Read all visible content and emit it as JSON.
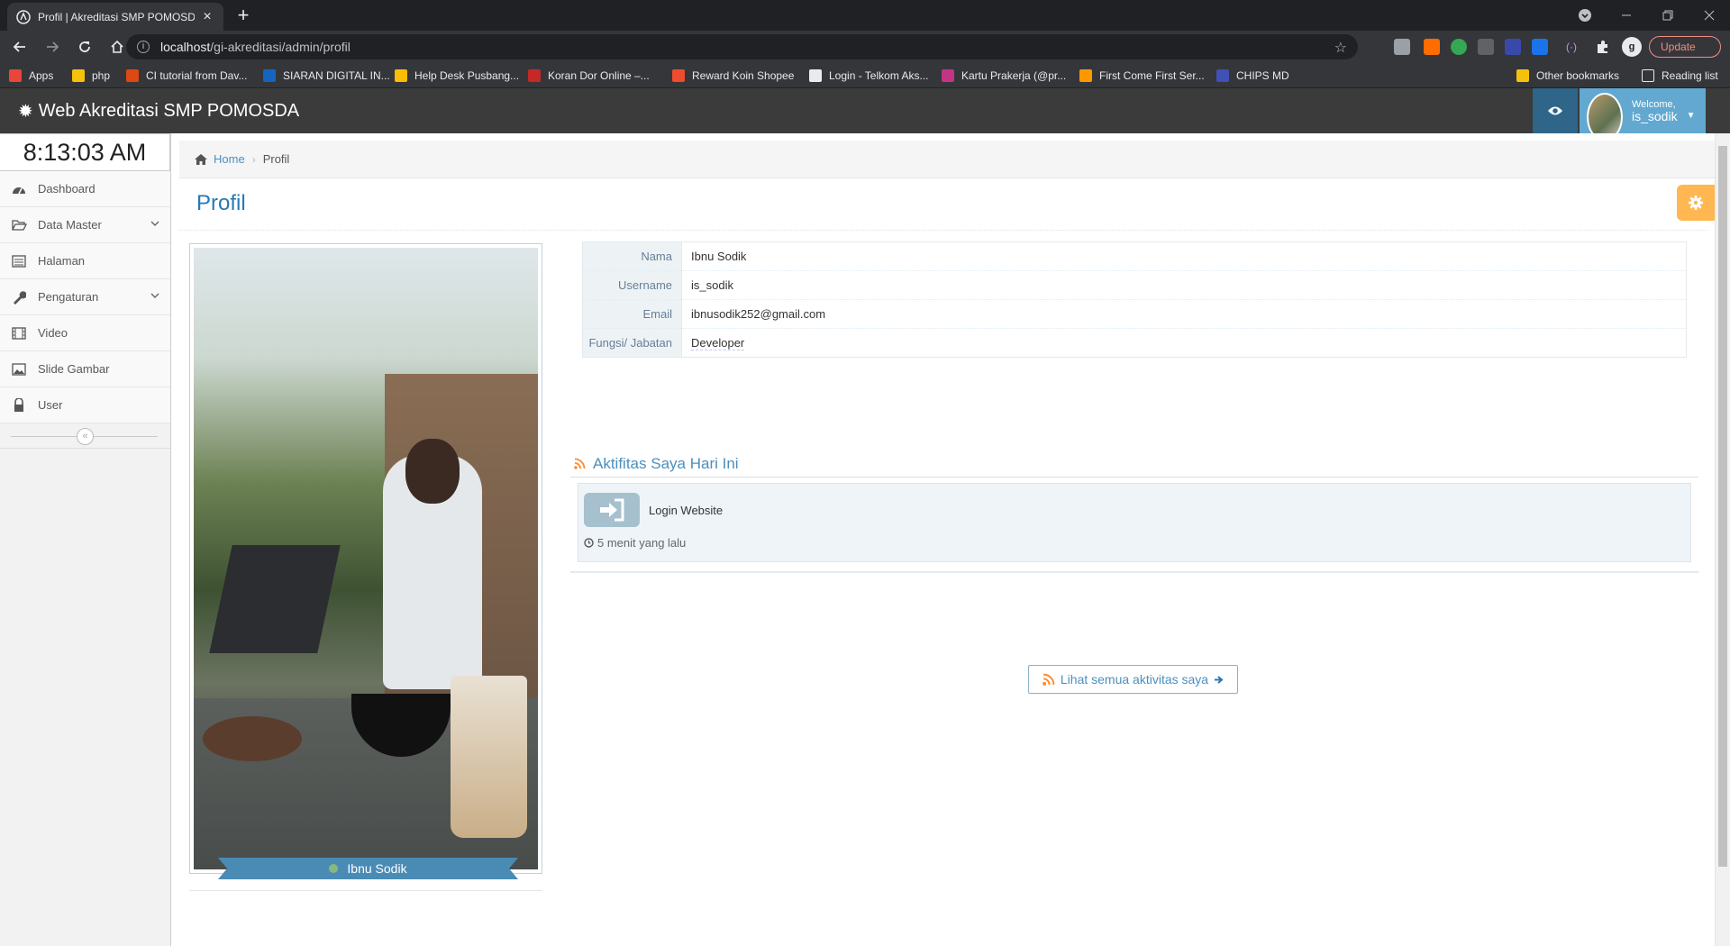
{
  "browser": {
    "tab_title": "Profil | Akreditasi SMP POMOSDA",
    "tab_close": "×",
    "new_tab": "+",
    "url_host": "localhost",
    "url_path": "/gi-akreditasi/admin/profil",
    "update_label": "Update",
    "bookmarks": [
      {
        "label": "Apps",
        "color": "#e8453c"
      },
      {
        "label": "php",
        "color": "#f4c20d"
      },
      {
        "label": "CI tutorial from Dav...",
        "color": "#dd4814"
      },
      {
        "label": "SIARAN DIGITAL IN...",
        "color": "#1565c0"
      },
      {
        "label": "Help Desk Pusbang...",
        "color": "#fbbc05"
      },
      {
        "label": "Koran Dor Online –...",
        "color": "#c62828"
      },
      {
        "label": "Reward Koin Shopee",
        "color": "#ee4d2d"
      },
      {
        "label": "Login - Telkom Aks...",
        "color": "#e8eaed"
      },
      {
        "label": "Kartu Prakerja (@pr...",
        "color": "#c13584"
      },
      {
        "label": "First Come First Ser...",
        "color": "#ff9800"
      },
      {
        "label": "CHIPS MD",
        "color": "#3f51b5"
      }
    ],
    "other_bookmarks": "Other bookmarks",
    "reading_list": "Reading list"
  },
  "app": {
    "brand": "Web Akreditasi SMP POMOSDA",
    "welcome": "Welcome,",
    "username": "is_sodik"
  },
  "sidebar": {
    "clock": "8:13:03 AM",
    "items": [
      {
        "label": "Dashboard",
        "icon": "dashboard-icon",
        "has_children": false
      },
      {
        "label": "Data Master",
        "icon": "folder-open-icon",
        "has_children": true
      },
      {
        "label": "Halaman",
        "icon": "list-icon",
        "has_children": false
      },
      {
        "label": "Pengaturan",
        "icon": "wrench-icon",
        "has_children": true
      },
      {
        "label": "Video",
        "icon": "film-icon",
        "has_children": false
      },
      {
        "label": "Slide Gambar",
        "icon": "picture-icon",
        "has_children": false
      },
      {
        "label": "User",
        "icon": "user-lock-icon",
        "has_children": false
      }
    ],
    "collapse": "«"
  },
  "breadcrumb": {
    "home": "Home",
    "current": "Profil"
  },
  "page": {
    "title": "Profil"
  },
  "profile": {
    "ribbon_name": "Ibnu Sodik",
    "rows": [
      {
        "key": "Nama",
        "value": "Ibnu Sodik"
      },
      {
        "key": "Username",
        "value": "is_sodik"
      },
      {
        "key": "Email",
        "value": "ibnusodik252@gmail.com"
      },
      {
        "key": "Fungsi/ Jabatan",
        "value": "Developer"
      }
    ]
  },
  "activity": {
    "header": "Aktifitas Saya Hari Ini",
    "items": [
      {
        "label": "Login Website",
        "time": "5 menit yang lalu"
      }
    ],
    "more_button": "Lihat semua aktivitas saya"
  },
  "colors": {
    "accent": "#4c8fbd",
    "title": "#2679b5",
    "navbar": "#3b3b3b",
    "user_button": "#62a8d1",
    "settings": "#ffb752"
  }
}
